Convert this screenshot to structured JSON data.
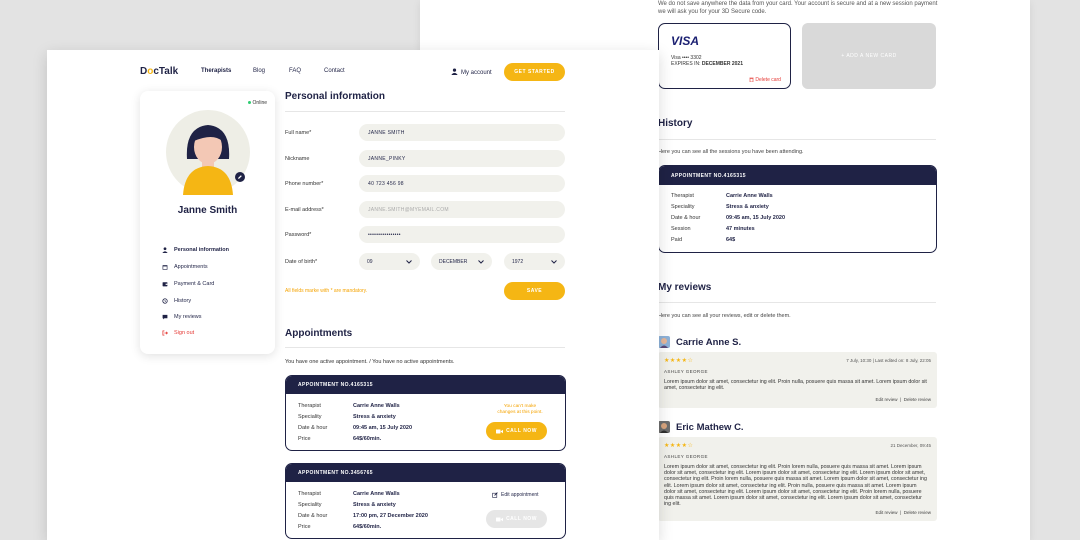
{
  "back": {
    "security_note": "We do not save anywhere the data from your card. Your account is secure and at a new session payment we will ask you for your 3D Secure code.",
    "card": {
      "brand": "VISA",
      "number": "Visa •••• 3302",
      "expires_label": "EXPIRES IN:",
      "expires_value": "DECEMBER 2021",
      "delete_label": "Delete card"
    },
    "add_card_label": "+ ADD A NEW CARD",
    "history": {
      "title": "History",
      "subtitle": "Here you can see all the sessions you have been attending.",
      "card_title": "APPOINTMENT NO.4165315",
      "rows": [
        {
          "label": "Therapist",
          "value": "Carrie Anne Walls"
        },
        {
          "label": "Speciality",
          "value": "Stress & anxiety"
        },
        {
          "label": "Date & hour",
          "value": "09:45 am, 15 July 2020"
        },
        {
          "label": "Session",
          "value": "47 minutes"
        },
        {
          "label": "Paid",
          "value": "64$"
        }
      ]
    },
    "reviews": {
      "title": "My reviews",
      "subtitle": "Here you can see all your reviews, edit or delete them.",
      "items": [
        {
          "name": "Carrie Anne S.",
          "stars": "★★★★☆",
          "date": "7 July, 10:30 | Last edited on: 8 July, 22:05",
          "author": "ASHLEY GEORGE",
          "body": "Lorem ipsum dolor sit amet, consectetur ing elit. Proin nulla, posuere quis massa sit amet. Lorem ipsum dolor sit amet, consectetur ing elit.",
          "edit": "Edit review",
          "delete": "Delete review"
        },
        {
          "name": "Eric Mathew C.",
          "stars": "★★★★☆",
          "date": "21 December, 09:45",
          "author": "ASHLEY GEORGE",
          "body": "Lorem ipsum dolor sit amet, consectetur ing elit. Proin lorem nulla, posuere quis massa sit amet. Lorem ipsum dolor sit amet, consectetur ing elit. Lorem ipsum dolor sit amet, consectetur ing elit. Lorem ipsum dolor sit amet, consectetur ing elit. Proin lorem nulla, posuere quis massa sit amet. Lorem ipsum dolor sit amet, consectetur ing elit. Lorem ipsum dolor sit amet, consectetur ing elit. Proin nulla, posuere quis massa sit amet. Lorem ipsum dolor sit amet, consectetur ing elit. Lorem ipsum dolor sit amet, consectetur ing elit. Proin lorem nulla, posuere quis massa sit amet. Lorem ipsum dolor sit amet, consectetur ing elit. Lorem ipsum dolor sit amet, consectetur ing elit.",
          "edit": "Edit review",
          "delete": "Delete review"
        }
      ]
    }
  },
  "header": {
    "logo_d": "D",
    "logo_o": "o",
    "logo_rest": "cTalk",
    "nav": [
      "Therapists",
      "Blog",
      "FAQ",
      "Contact"
    ],
    "my_account": "My account",
    "cta": "GET STARTED"
  },
  "profile": {
    "status": "Online",
    "name": "Janne Smith",
    "menu": [
      "Personal information",
      "Appointments",
      "Payment & Card",
      "History",
      "My reviews",
      "Sign out"
    ]
  },
  "personal": {
    "title": "Personal information",
    "fields": [
      {
        "label": "Full name*",
        "value": "JANNE SMITH"
      },
      {
        "label": "Nickname",
        "value": "JANNE_PINKY"
      },
      {
        "label": "Phone number*",
        "value": "40 723 456 98"
      },
      {
        "label": "E-mail address*",
        "value": "JANNE.SMITH@MYEMAIL.COM"
      },
      {
        "label": "Password*",
        "value": "••••••••••••••••"
      }
    ],
    "dob_label": "Date of birth*",
    "dob_day": "09",
    "dob_month": "DECEMBER",
    "dob_year": "1972",
    "note": "All fields marke with * are mandatory.",
    "save": "SAVE"
  },
  "appointments": {
    "title": "Appointments",
    "subtitle": "You have one active appointment. / You have no active appointments.",
    "items": [
      {
        "title": "APPOINTMENT NO.4165315",
        "rows": [
          {
            "label": "Therapist",
            "value": "Carrie Anne Walls"
          },
          {
            "label": "Speciality",
            "value": "Stress & anxiety"
          },
          {
            "label": "Date & hour",
            "value": "09:45 am, 15 July 2020"
          },
          {
            "label": "Price",
            "value": "64$/60min."
          }
        ],
        "warning_l1": "You can't make",
        "warning_l2": "changes at this point.",
        "call": "CALL NOW"
      },
      {
        "title": "APPOINTMENT NO.3456765",
        "rows": [
          {
            "label": "Therapist",
            "value": "Carrie Anne Walls"
          },
          {
            "label": "Speciality",
            "value": "Stress & anxiety"
          },
          {
            "label": "Date & hour",
            "value": "17:00 pm, 27 December 2020"
          },
          {
            "label": "Price",
            "value": "64$/60min."
          }
        ],
        "edit": "Edit appointment",
        "call": "CALL NOW"
      }
    ]
  },
  "colors": {
    "navy": "#1f2245",
    "accent": "#f5b614",
    "danger": "#e53935",
    "field_bg": "#f1f1ec"
  }
}
